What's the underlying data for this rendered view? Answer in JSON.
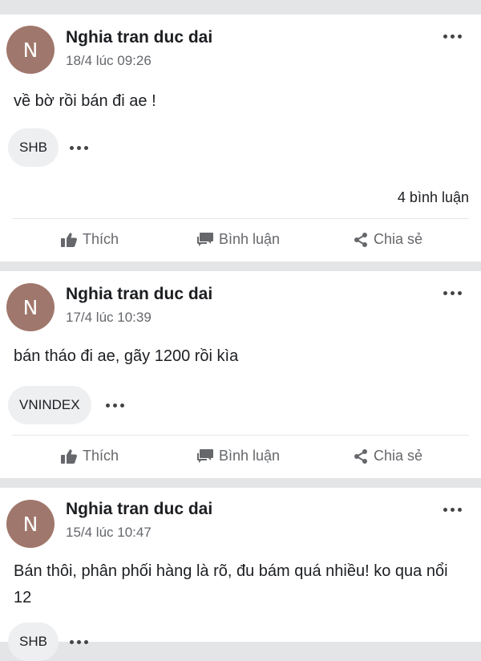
{
  "posts": [
    {
      "avatar_letter": "N",
      "author": "Nghia tran duc dai",
      "time": "18/4 lúc 09:26",
      "content": "về bờ rồi bán đi ae !",
      "tag": "SHB",
      "comments": "4 bình luận"
    },
    {
      "avatar_letter": "N",
      "author": "Nghia tran duc dai",
      "time": "17/4 lúc 10:39",
      "content": "bán tháo đi ae, gãy 1200 rồi kìa",
      "tag": "VNINDEX"
    },
    {
      "avatar_letter": "N",
      "author": "Nghia tran duc dai",
      "time": "15/4 lúc 10:47",
      "content": "Bán thôi, phân phối hàng là rõ, đu bám quá nhiều! ko qua nổi 12",
      "tag": "SHB"
    }
  ],
  "actions": {
    "like": "Thích",
    "comment": "Bình luận",
    "share": "Chia sẻ"
  },
  "colors": {
    "avatar": "#a0776c",
    "separator": "#e4e5e7",
    "tag_bg": "#eeeff1",
    "muted_text": "#65676b"
  },
  "icons": [
    "more-icon",
    "like-icon",
    "comment-icon",
    "share-icon"
  ]
}
